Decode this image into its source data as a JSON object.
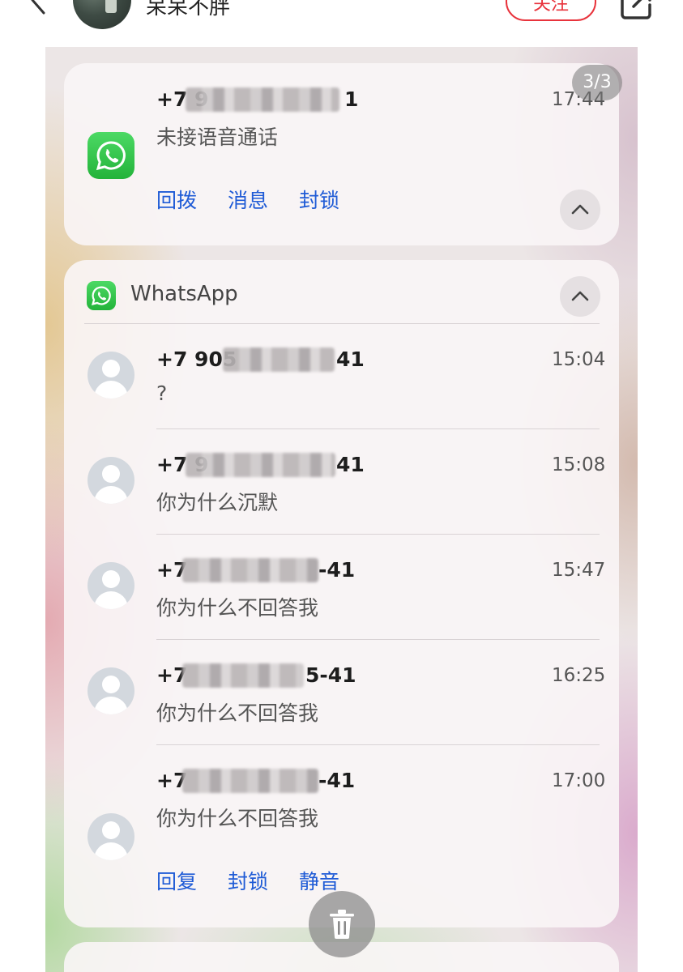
{
  "header": {
    "username": "呆呆不胖",
    "follow_label": "关注"
  },
  "page_indicator": "3/3",
  "call_notification": {
    "phone": "+7 9",
    "phone_suffix": "1",
    "time": "17:44",
    "message": "未接语音通话",
    "actions": [
      "回拨",
      "消息",
      "封锁"
    ]
  },
  "whatsapp_group": {
    "app_name": "WhatsApp",
    "messages": [
      {
        "phone_prefix": "+7 905",
        "phone_suffix": "41",
        "time": "15:04",
        "text": "?"
      },
      {
        "phone_prefix": "+7 9",
        "phone_suffix": "41",
        "time": "15:08",
        "text": "你为什么沉默"
      },
      {
        "phone_prefix": "+7",
        "phone_suffix": "-41",
        "time": "15:47",
        "text": "你为什么不回答我"
      },
      {
        "phone_prefix": "+7",
        "phone_suffix": "5-41",
        "time": "16:25",
        "text": "你为什么不回答我"
      },
      {
        "phone_prefix": "+7",
        "phone_suffix": "-41",
        "time": "17:00",
        "text": "你为什么不回答我"
      }
    ],
    "actions": [
      "回复",
      "封锁",
      "静音"
    ]
  },
  "colors": {
    "accent_red": "#e8333c",
    "action_blue": "#1f5bd6",
    "whatsapp_green": "#2fc24a"
  },
  "icons": [
    "back-arrow-icon",
    "share-icon",
    "whatsapp-icon",
    "chevron-up-icon",
    "default-avatar-icon",
    "trash-icon"
  ]
}
